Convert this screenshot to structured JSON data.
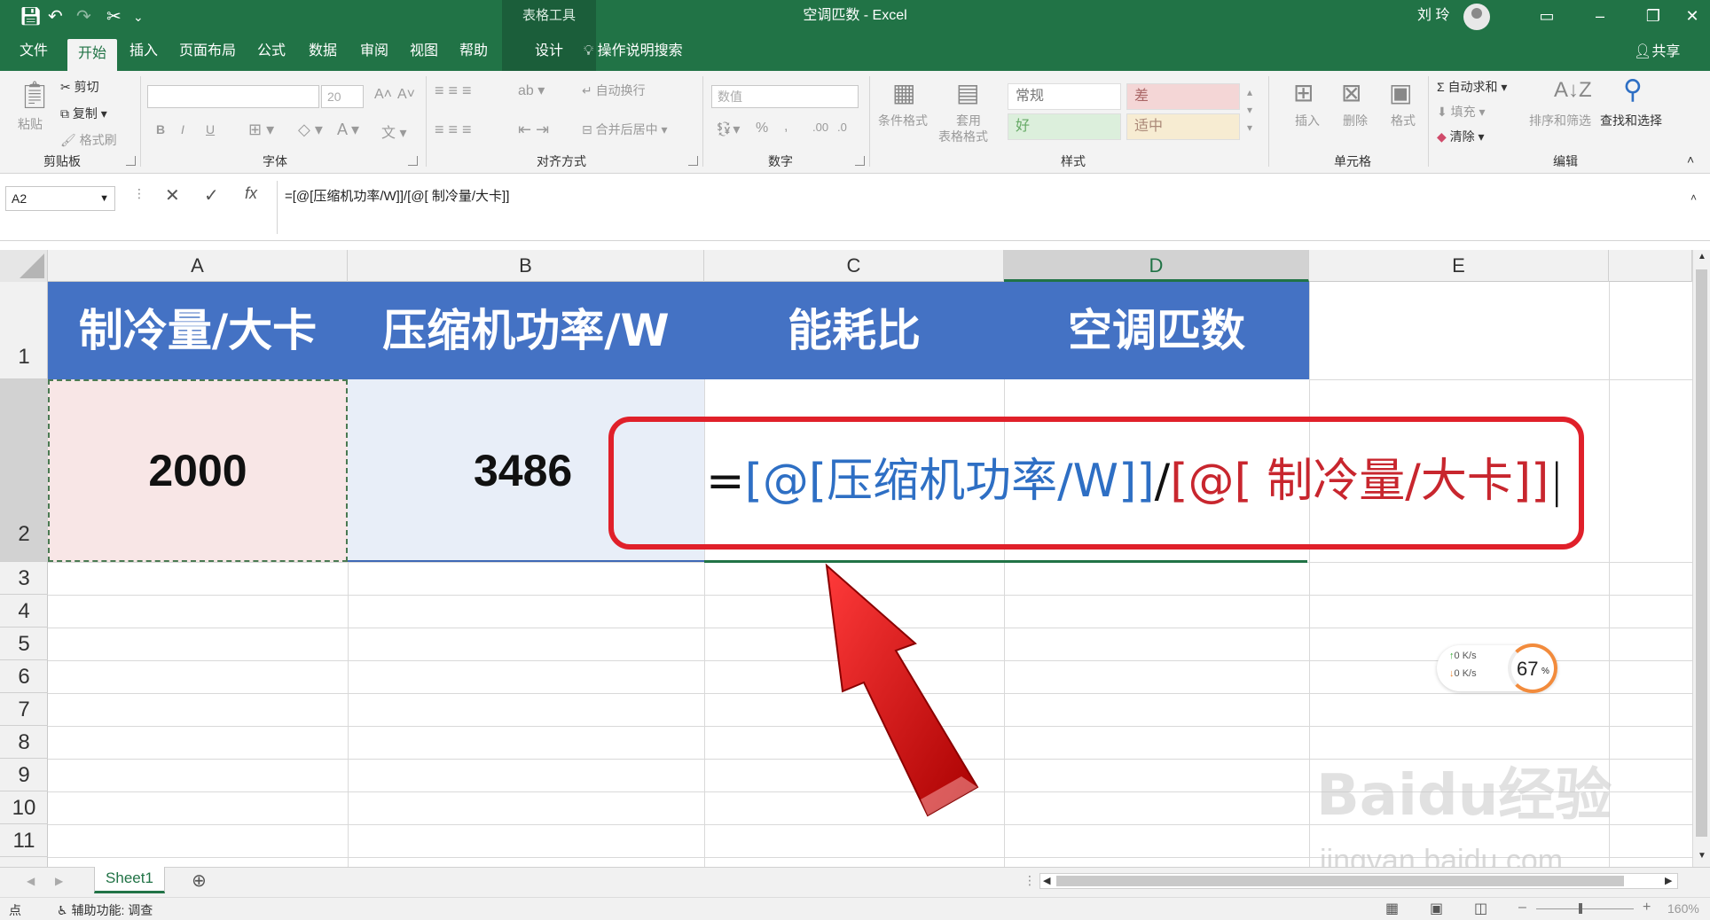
{
  "titlebar": {
    "quick_access": [
      "save-icon",
      "undo-icon",
      "redo-icon",
      "customize-icon"
    ],
    "context_tools_label": "表格工具",
    "document_title": "空调匹数 - Excel",
    "user_name": "刘 玲"
  },
  "tabs": [
    "文件",
    "开始",
    "插入",
    "页面布局",
    "公式",
    "数据",
    "审阅",
    "视图",
    "帮助",
    "设计"
  ],
  "active_tab": "开始",
  "tell_me": "操作说明搜索",
  "share_label": "共享",
  "ribbon": {
    "clipboard": {
      "paste": "粘贴",
      "cut": "剪切",
      "copy": "复制",
      "format_painter": "格式刷",
      "label": "剪贴板"
    },
    "font": {
      "font_size": "20",
      "bold": "B",
      "italic": "I",
      "underline": "U",
      "label": "字体"
    },
    "alignment": {
      "wrap": "自动换行",
      "merge": "合并后居中",
      "label": "对齐方式"
    },
    "number": {
      "format": "数值",
      "percent": "%",
      "comma": ",",
      "label": "数字"
    },
    "styles": {
      "conditional": "条件格式",
      "table_format_1": "套用",
      "table_format_2": "表格格式",
      "normal": "常规",
      "bad": "差",
      "good": "好",
      "neutral": "适中",
      "label": "样式"
    },
    "cells": {
      "insert": "插入",
      "delete": "删除",
      "format": "格式",
      "label": "单元格"
    },
    "editing": {
      "autosum": "自动求和",
      "fill": "填充",
      "clear": "清除",
      "sort": "排序和筛选",
      "find": "查找和选择",
      "label": "编辑"
    }
  },
  "namebox": "A2",
  "formula_bar": {
    "cancel": "✕",
    "enter": "✓",
    "fx": "fx",
    "formula": "=[@[压缩机功率/W]]/[@[ 制冷量/大卡]]"
  },
  "columns": [
    "A",
    "B",
    "C",
    "D",
    "E"
  ],
  "rows": [
    "1",
    "2",
    "3",
    "4",
    "5",
    "6",
    "7",
    "8",
    "9",
    "10",
    "11"
  ],
  "headers": [
    "制冷量/大卡",
    "压缩机功率/W",
    "能耗比",
    "空调匹数"
  ],
  "row2": {
    "a": "2000",
    "b": "3486"
  },
  "editing_formula": {
    "eq": "=",
    "part1": "[@[压缩机功率/W]]",
    "slash": "/",
    "part2": "[@[ 制冷量/大卡]]"
  },
  "net_widget": {
    "up": "0",
    "up_unit": "K/s",
    "down": "0",
    "down_unit": "K/s",
    "percent": "67",
    "percent_sign": "%"
  },
  "watermark": {
    "brand": "Baidu经验",
    "url": "jingyan.baidu.com"
  },
  "sheet_tab": "Sheet1",
  "status": {
    "mode": "点",
    "accessibility": "辅助功能: 调查",
    "zoom": "160%"
  },
  "colors": {
    "excel_green": "#217346",
    "header_blue": "#4472c4",
    "callout_red": "#e0202a",
    "ref_blue": "#2e6fc4",
    "ref_red": "#c8262e"
  }
}
